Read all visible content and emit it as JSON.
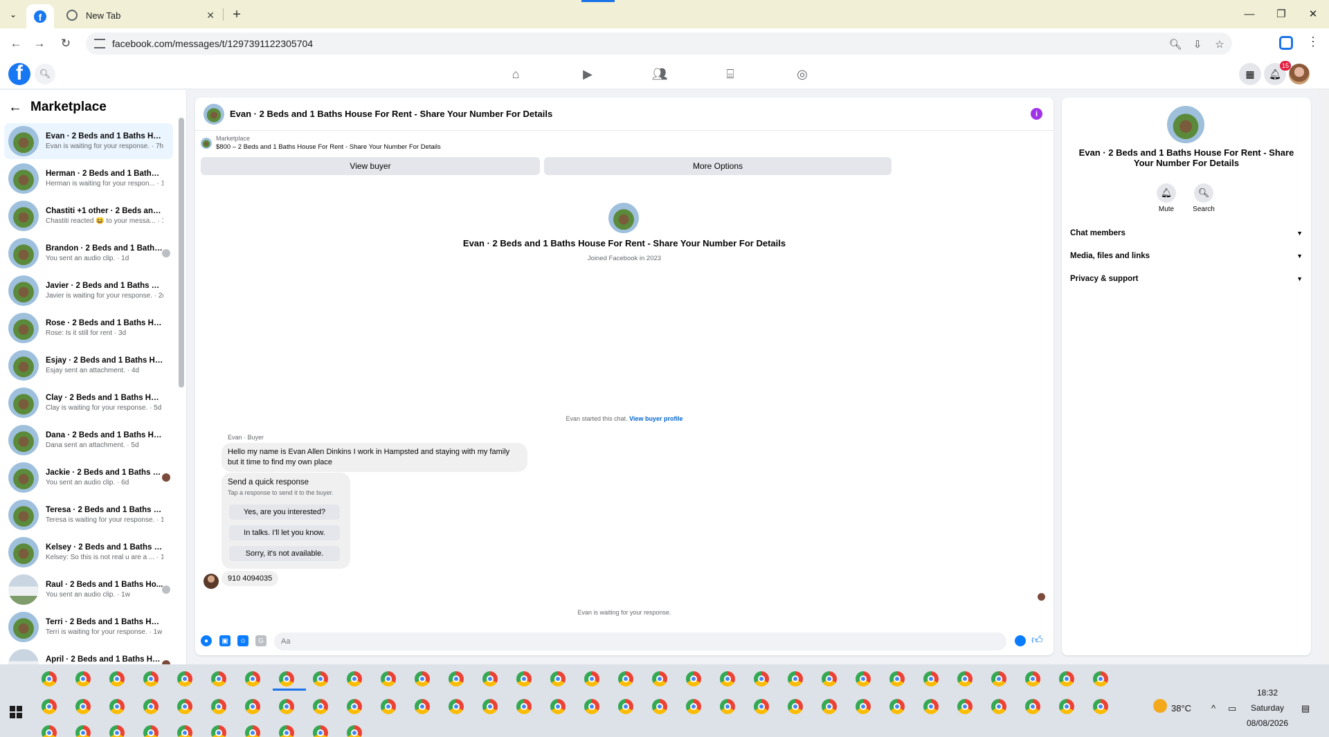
{
  "browser": {
    "tabs": [
      {
        "label": "",
        "icon": "facebook-icon",
        "active": true
      },
      {
        "label": "New Tab",
        "icon": "chrome-icon",
        "active": false
      }
    ],
    "url": "facebook.com/messages/t/1297391122305704"
  },
  "fb": {
    "notifications_count": "15",
    "nav_icons": [
      "home-icon",
      "video-icon",
      "friends-icon",
      "marketplace-icon",
      "groups-icon"
    ]
  },
  "sidebar": {
    "title": "Marketplace",
    "conversations": [
      {
        "name": "Evan · 2 Beds and 1 Baths Hous...",
        "preview": "Evan is waiting for your response. · 7h",
        "active": true
      },
      {
        "name": "Herman · 2 Beds and 1 Baths H...",
        "preview": "Herman is waiting for your respon... · 1d"
      },
      {
        "name": "Chastiti +1 other · 2 Beds and 1 ...",
        "preview": "Chastiti reacted 😆 to your messa... · 1d"
      },
      {
        "name": "Brandon · 2 Beds and 1 Baths...",
        "preview": "You sent an audio clip. · 1d"
      },
      {
        "name": "Javier · 2 Beds and 1 Baths Hou...",
        "preview": "Javier is waiting for your response. · 2d"
      },
      {
        "name": "Rose · 2 Beds and 1 Baths Hous...",
        "preview": "Rose: Is it still for rent · 3d"
      },
      {
        "name": "Esjay · 2 Beds and 1 Baths Hous...",
        "preview": "Esjay sent an attachment. · 4d"
      },
      {
        "name": "Clay · 2 Beds and 1 Baths House...",
        "preview": "Clay is waiting for your response. · 5d"
      },
      {
        "name": "Dana · 2 Beds and 1 Baths Hous...",
        "preview": "Dana sent an attachment. · 5d"
      },
      {
        "name": "Jackie · 2 Beds and 1 Baths H...",
        "preview": "You sent an audio clip. · 6d"
      },
      {
        "name": "Teresa · 2 Beds and 1 Baths Hou...",
        "preview": "Teresa is waiting for your response. · 1w"
      },
      {
        "name": "Kelsey · 2 Beds and 1 Baths Hou...",
        "preview": "Kelsey: So this is not real u are a ... · 1w"
      },
      {
        "name": "Raul · 2 Beds and 1 Baths Ho...",
        "preview": "You sent an audio clip. · 1w"
      },
      {
        "name": "Terri · 2 Beds and 1 Baths House...",
        "preview": "Terri is waiting for your response. · 1w"
      },
      {
        "name": "April · 2 Beds and 1 Baths Ho...",
        "preview": "You sent an audio clip. · 1w"
      }
    ]
  },
  "chat": {
    "title": "Evan · 2 Beds and 1 Baths House For Rent - Share Your Number For Details",
    "listing_label": "Marketplace",
    "listing_desc": "$800 – 2 Beds and 1 Baths House For Rent - Share Your Number For Details",
    "view_buyer": "View buyer",
    "more_options": "More Options",
    "intro_name": "Evan · 2 Beds and 1 Baths House For Rent - Share Your Number For Details",
    "intro_sub": "Joined Facebook in 2023",
    "started_text": "Evan started this chat.",
    "view_buyer_profile": "View buyer profile",
    "sender_label": "Evan · Buyer",
    "message": "Hello my name is Evan Allen Dinkins  I work in Hampsted and staying with my family but it time to find my own place",
    "quick_title": "Send a quick response",
    "quick_sub": "Tap a response to send it to the buyer.",
    "quick_options": [
      "Yes, are you interested?",
      "In talks. I'll let you know.",
      "Sorry, it's not available."
    ],
    "phone_message": "910 4094035",
    "waiting_text": "Evan is waiting for your response.",
    "composer_placeholder": "Aa"
  },
  "details": {
    "name": "Evan · 2 Beds and 1 Baths House For Rent - Share Your Number For Details",
    "mute": "Mute",
    "search": "Search",
    "sections": [
      "Chat members",
      "Media, files and links",
      "Privacy & support"
    ]
  },
  "taskbar": {
    "temperature": "38°C",
    "time": "18:32",
    "day": "Saturday",
    "date": "08/08/2026",
    "notif_count": "2"
  }
}
